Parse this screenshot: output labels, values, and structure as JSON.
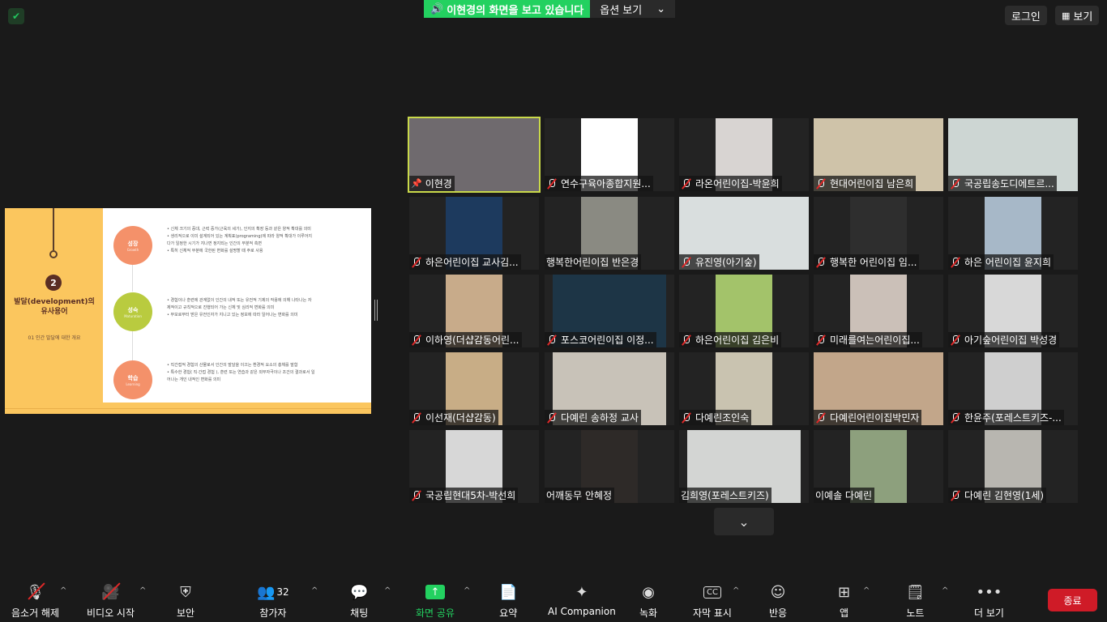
{
  "top": {
    "share_banner": "이현경의 화면을 보고 있습니다",
    "view_options": "옵션 보기",
    "login": "로그인",
    "view": "보기"
  },
  "slide": {
    "number": "2",
    "title": "발달(development)의 유사용어",
    "subtitle": "01 인간 발달에 대한 개요",
    "terms": [
      {
        "name": "성장",
        "eng": "Growth",
        "color": "#f4916a"
      },
      {
        "name": "성숙",
        "eng": "Maturation",
        "color": "#b9cb3f"
      },
      {
        "name": "학습",
        "eng": "Learning",
        "color": "#f4916a"
      }
    ],
    "bullets_growth": [
      "• 신체 크기의 증대, 근력 증가(근육의 세기), 인지의 확장 등과 같은 양적 확대를 의미",
      "• 생리적으로 이미 설계되어 있는 계획표(programing)에 따라 양적 확대가 이루어지",
      "  다가 일정한 시기가 지나면 정지되는 인간의 부분적 측면",
      "• 특히 신체적 부분에 국한된 변화를 설명할 때 주로 사용"
    ],
    "bullets_maturation": [
      "• 경험이나 훈련에 관계없이 인간의 내적 또는 유전적 기제의 작용에 의해 나타나는 자",
      "  제적이고 규칙적으로 진행되어 가는 신체 및 심리적 변화를 의미",
      "• 부모로부터 받은 유전인자가 지니고 있는 정보에 따라 일어나는 변화를 의미"
    ],
    "bullets_learning": [
      "• 직간접적 경험의 산물로서 인간의 발달을 이끄는 환경적 요소의 총체를 말함",
      "• 특수한 경험( 직·간접 경험 ), 훈련 또는 연습과 같은 외부자극이나 조건의 결과로서 일",
      "  어나는 개인 내적인 변화를 의미"
    ]
  },
  "participants": [
    {
      "name": "이현경",
      "muted": false,
      "pinned": true,
      "active": true,
      "bg": "#6f6a6e"
    },
    {
      "name": "연수구육아종합지원...",
      "muted": true,
      "bg": "#ffffff"
    },
    {
      "name": "라온어린이집-박윤희",
      "muted": true,
      "bg": "#d8d4d2"
    },
    {
      "name": "현대어린이집 남은희",
      "muted": true,
      "bg": "#cfc3a9"
    },
    {
      "name": "국공립송도디에트르...",
      "muted": true,
      "bg": "#cdd6d3"
    },
    {
      "name": "하은어린이집 교사김...",
      "muted": true,
      "bg": "#1d3a5e"
    },
    {
      "name": "행복한어린이집 반은경",
      "muted": false,
      "bg": "#8a8a82"
    },
    {
      "name": "유진영(아기숲)",
      "muted": true,
      "bg": "#d9dede"
    },
    {
      "name": "행복한  어린이집 임...",
      "muted": true,
      "bg": "#2e2e2e"
    },
    {
      "name": "하은 어린이집 윤지희",
      "muted": true,
      "bg": "#a7b8c8"
    },
    {
      "name": "이하영(더샵감동어린...",
      "muted": true,
      "bg": "#c8ab8a"
    },
    {
      "name": "포스코어린이집  이정...",
      "muted": true,
      "bg": "#1d3546"
    },
    {
      "name": "하은어린이집 김은비",
      "muted": true,
      "bg": "#a3c36a"
    },
    {
      "name": "미래를여는어린이집...",
      "muted": true,
      "bg": "#cbc0b8"
    },
    {
      "name": "아기숲어린이집 박성경",
      "muted": true,
      "bg": "#d8d8d8"
    },
    {
      "name": "이선재(더샵감동)",
      "muted": true,
      "bg": "#c8ad86"
    },
    {
      "name": "다예린 송하정 교사",
      "muted": true,
      "bg": "#c8c2b8"
    },
    {
      "name": "다예린조인숙",
      "muted": true,
      "bg": "#c9c3b0"
    },
    {
      "name": "다예린어린이집박민자",
      "muted": true,
      "bg": "#c2a68a"
    },
    {
      "name": "한윤주(포레스트키즈-...",
      "muted": true,
      "bg": "#cfcfcf"
    },
    {
      "name": "국공립현대5차-박선희",
      "muted": true,
      "bg": "#d7d7d7"
    },
    {
      "name": "어깨동무 안혜정",
      "muted": false,
      "bg": "#2e2a28"
    },
    {
      "name": "김희영(포레스트키즈)",
      "muted": false,
      "bg": "#d3d5d3"
    },
    {
      "name": "이예솔 다예린",
      "muted": false,
      "bg": "#8da07d"
    },
    {
      "name": "다예린 김현영(1세)",
      "muted": true,
      "bg": "#b8b6b0"
    }
  ],
  "toolbar": {
    "unmute": "음소거 해제",
    "start_video": "비디오 시작",
    "security": "보안",
    "participants": "참가자",
    "participants_count": "32",
    "chat": "채팅",
    "share_screen": "화면 공유",
    "summary": "요약",
    "ai_companion": "AI Companion",
    "record": "녹화",
    "captions": "자막 표시",
    "reactions": "반응",
    "apps": "앱",
    "notes": "노트",
    "more": "더 보기",
    "end": "종료"
  }
}
